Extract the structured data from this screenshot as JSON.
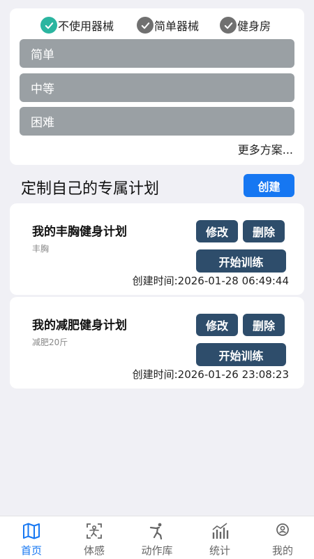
{
  "filters": [
    {
      "label": "不使用器械",
      "checked": true
    },
    {
      "label": "简单器械",
      "checked": false
    },
    {
      "label": "健身房",
      "checked": false
    }
  ],
  "levels": [
    "简单",
    "中等",
    "困难"
  ],
  "more_label": "更多方案...",
  "custom": {
    "title": "定制自己的专属计划",
    "create_label": "创建"
  },
  "plans": [
    {
      "name": "我的丰胸健身计划",
      "desc": "丰胸",
      "edit_label": "修改",
      "delete_label": "删除",
      "start_label": "开始训练",
      "created": "创建时间:2026-01-28 06:49:44"
    },
    {
      "name": "我的减肥健身计划",
      "desc": "减肥20斤",
      "edit_label": "修改",
      "delete_label": "删除",
      "start_label": "开始训练",
      "created": "创建时间:2026-01-26 23:08:23"
    }
  ],
  "tabs": [
    {
      "label": "首页",
      "icon": "map-icon",
      "active": true
    },
    {
      "label": "体感",
      "icon": "motion-sensing-icon",
      "active": false
    },
    {
      "label": "动作库",
      "icon": "exercise-icon",
      "active": false
    },
    {
      "label": "统计",
      "icon": "stats-icon",
      "active": false
    },
    {
      "label": "我的",
      "icon": "profile-icon",
      "active": false
    }
  ],
  "colors": {
    "accent": "#1677f2",
    "check_active": "#2bb5a0",
    "check_inactive": "#707070",
    "level_bg": "#9aa0a4",
    "button_bg": "#2e4d6b"
  }
}
